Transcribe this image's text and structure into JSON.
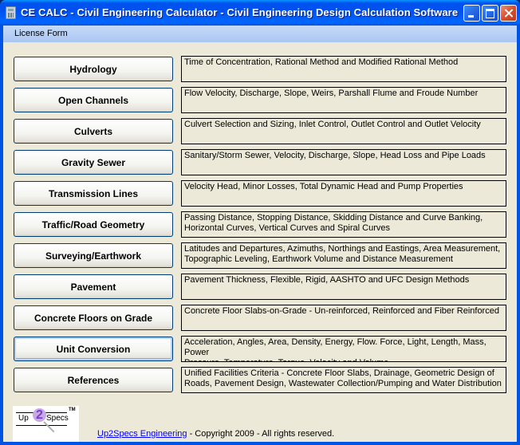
{
  "window": {
    "title": "CE CALC - Civil Engineering Calculator - Civil Engineering Design Calculation Software",
    "controls": [
      "minimize",
      "maximize",
      "close"
    ]
  },
  "menubar": {
    "items": [
      {
        "label": "License Form"
      }
    ]
  },
  "modules": [
    {
      "label": "Hydrology",
      "description": "Time of Concentration, Rational Method and Modified Rational Method"
    },
    {
      "label": "Open Channels",
      "description": "Flow Velocity, Discharge, Slope, Weirs, Parshall Flume and Froude Number"
    },
    {
      "label": "Culverts",
      "description": "Culvert Selection and Sizing, Inlet Control, Outlet Control and Outlet Velocity"
    },
    {
      "label": "Gravity Sewer",
      "description": "Sanitary/Storm Sewer, Velocity, Discharge, Slope, Head Loss and Pipe Loads"
    },
    {
      "label": "Transmission Lines",
      "description": "Velocity Head, Minor Losses, Total Dynamic Head and Pump Properties"
    },
    {
      "label": "Traffic/Road Geometry",
      "description": "Passing Distance, Stopping Distance, Skidding Distance and Curve Banking,\nHorizontal Curves, Vertical Curves and Spiral Curves"
    },
    {
      "label": "Surveying/Earthwork",
      "description": "Latitudes and Departures, Azimuths, Northings and Eastings, Area Measurement,\nTopographic Leveling, Earthwork Volume and Distance Measurement"
    },
    {
      "label": "Pavement",
      "description": "Pavement Thickness, Flexible, Rigid, AASHTO and UFC Design Methods"
    },
    {
      "label": "Concrete Floors on Grade",
      "description": "Concrete Floor Slabs-on-Grade - Un-reinforced, Reinforced and Fiber Reinforced"
    },
    {
      "label": "Unit Conversion",
      "description": "Acceleration, Angles, Area, Density, Energy, Flow. Force, Light, Length, Mass, Power\nPressure, Temperature, Torque, Velocity and Volume",
      "state": "hover"
    },
    {
      "label": "References",
      "description": "Unified Facilities Criteria - Concrete Floor Slabs, Drainage, Geometric Design of\nRoads, Pavement Design, Wastewater Collection/Pumping and Water Distribution"
    }
  ],
  "logo": {
    "left": "Up",
    "middle": "2",
    "right": "Specs",
    "tm": "TM"
  },
  "footer": {
    "link": "Up2Specs Engineering",
    "text": " - Copyright 2009 - All rights reserved."
  }
}
